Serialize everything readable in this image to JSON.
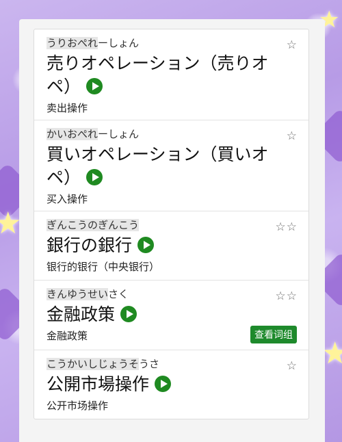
{
  "entries": [
    {
      "reading_hl": "うりおぺれ",
      "reading_rest": "ーしょん",
      "word_line1": "売りオペレーション（売りオ",
      "word_line2": "ペ）",
      "meaning": "卖出操作",
      "stars": "☆"
    },
    {
      "reading_hl": "かいおぺれ",
      "reading_rest": "ーしょん",
      "word_line1": "買いオペレーション（買いオ",
      "word_line2": "ペ）",
      "meaning": "买入操作",
      "stars": "☆"
    },
    {
      "reading_hl": "ぎんこうのぎんこう",
      "reading_rest": "",
      "word_line1": "銀行の銀行",
      "word_line2": "",
      "meaning": "银行的银行（中央银行）",
      "stars": "☆☆"
    },
    {
      "reading_hl": "きんゆうせい",
      "reading_rest": "さく",
      "word_line1": "金融政策",
      "word_line2": "",
      "meaning": "金融政策",
      "stars": "☆☆",
      "phrase_button": "查看词组"
    },
    {
      "reading_hl": "こうかいしじょうそ",
      "reading_rest": "うさ",
      "word_line1": "公開市場操作",
      "word_line2": "",
      "meaning": "公开市场操作",
      "stars": "☆"
    }
  ],
  "colors": {
    "play_button": "#1f8a21",
    "phrase_button": "#1e8a2c",
    "background": "#c3aced"
  },
  "icons": {
    "play": "play-icon",
    "star": "star-outline-icon"
  }
}
